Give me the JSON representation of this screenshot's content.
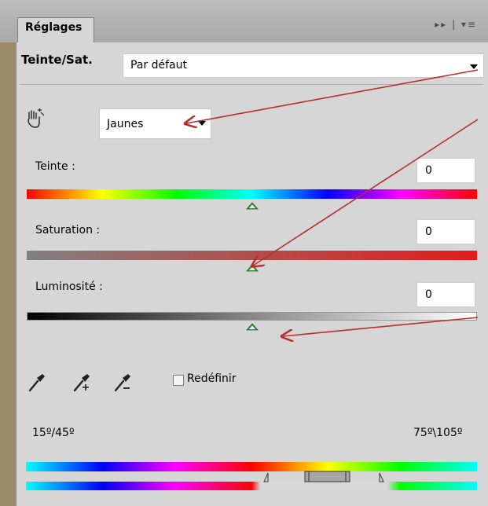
{
  "panel": {
    "tab_label": "Réglages",
    "tab_controls": "▸▸ | ▾≡",
    "title": "Teinte/Sat.",
    "preset": {
      "value": "Par défaut"
    },
    "channel": {
      "value": "Jaunes"
    }
  },
  "sliders": {
    "hue": {
      "label": "Teinte :",
      "value": "0",
      "level": 0.5
    },
    "saturation": {
      "label": "Saturation :",
      "value": "0",
      "level": 0.5
    },
    "lightness": {
      "label": "Luminosité :",
      "value": "0",
      "level": 0.5
    }
  },
  "tools": {
    "colorize_label": "Redéfinir",
    "colorize_checked": false,
    "icons": [
      "eyedropper-icon",
      "eyedropper-plus-icon",
      "eyedropper-minus-icon"
    ]
  },
  "range": {
    "left": "15º/45º",
    "right": "75º\\105º"
  },
  "colors": {
    "panel_bg": "#d6d6d6",
    "annotation_arrow": "#b5302c",
    "slider_thumb": "#3d9b3d"
  }
}
